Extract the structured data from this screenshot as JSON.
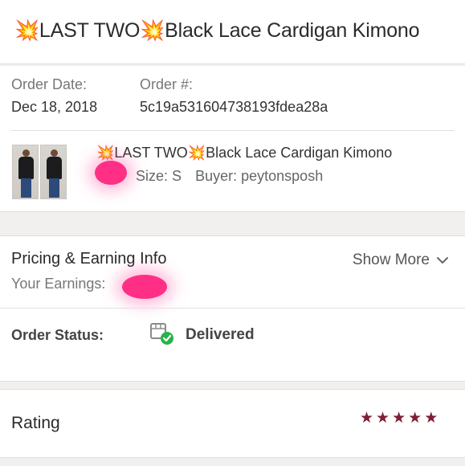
{
  "header": {
    "title": "💥LAST TWO💥Black Lace Cardigan Kimono"
  },
  "order": {
    "date_label": "Order Date:",
    "date_value": "Dec 18, 2018",
    "number_label": "Order #:",
    "number_value": "5c19a531604738193fdea28a"
  },
  "item": {
    "thumbnail_count": 2,
    "title": "💥LAST TWO💥Black Lace Cardigan Kimono",
    "size_label": "Size:",
    "size_value": "S",
    "buyer_label": "Buyer:",
    "buyer_value": "peytonsposh"
  },
  "pricing": {
    "title": "Pricing & Earning Info",
    "earnings_label": "Your Earnings:",
    "show_more_label": "Show More",
    "show_more_icon": "chevron-down-icon"
  },
  "status": {
    "label": "Order Status:",
    "value": "Delivered",
    "icon": "package-delivered-icon"
  },
  "rating": {
    "title": "Rating",
    "stars": 5,
    "max_stars": 5,
    "star_glyph": "★",
    "star_color": "#7f1e35"
  },
  "colors": {
    "redaction": "#ff2f86",
    "delivered_check": "#27b24a",
    "background": "#f2f0ee"
  }
}
